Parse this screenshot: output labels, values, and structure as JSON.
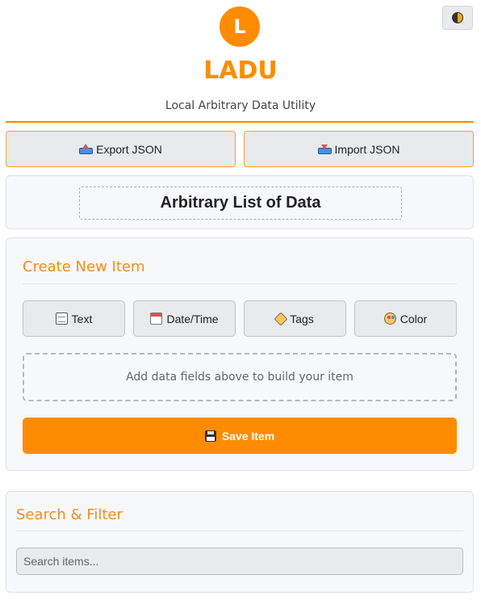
{
  "header": {
    "logo_letter": "L",
    "title": "LADU",
    "subtitle": "Local Arbitrary Data Utility",
    "theme_toggle_icon": "half-circle-icon"
  },
  "actions": {
    "export_label": "Export JSON",
    "import_label": "Import JSON"
  },
  "list": {
    "title": "Arbitrary List of Data"
  },
  "create": {
    "heading": "Create New Item",
    "fields": [
      {
        "label": "Text",
        "icon": "memo-icon"
      },
      {
        "label": "Date/Time",
        "icon": "calendar-icon"
      },
      {
        "label": "Tags",
        "icon": "tag-icon"
      },
      {
        "label": "Color",
        "icon": "palette-icon"
      }
    ],
    "placeholder": "Add data fields above to build your item",
    "save_label": "Save Item"
  },
  "search": {
    "heading": "Search & Filter",
    "placeholder": "Search items..."
  },
  "colors": {
    "accent": "#ff8c00",
    "panel_bg": "#f7f8fa",
    "button_bg": "#e8eaed"
  }
}
